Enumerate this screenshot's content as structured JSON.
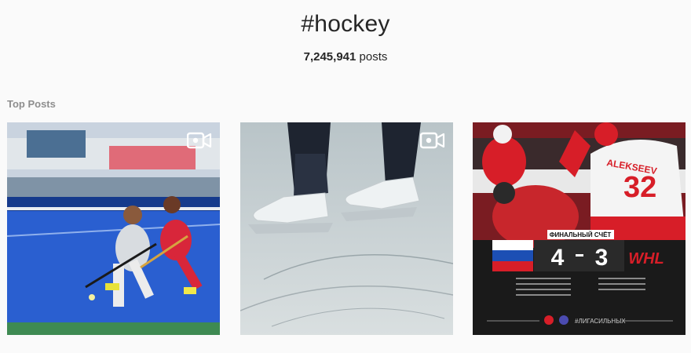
{
  "header": {
    "hashtag": "#hockey",
    "count_value": "7,245,941",
    "count_suffix": "posts"
  },
  "sections": {
    "top_posts_label": "Top Posts"
  },
  "posts": [
    {
      "icon": "video-icon",
      "scene": "field-hockey-players"
    },
    {
      "icon": "video-icon",
      "scene": "figure-skates-on-ice"
    },
    {
      "scene": "khl-final-score",
      "jersey_name": "ALEKSEEV",
      "jersey_number": "32",
      "score_label": "ФИНАЛЬНЫЙ СЧЁТ",
      "score_home": "4",
      "score_away": "3",
      "team_logo": "WHL",
      "hashtag_caption": "#ЛИГАСИЛЬНЫХ",
      "colors": {
        "red": "#d71e28",
        "dark": "#1a1a1a"
      }
    }
  ]
}
